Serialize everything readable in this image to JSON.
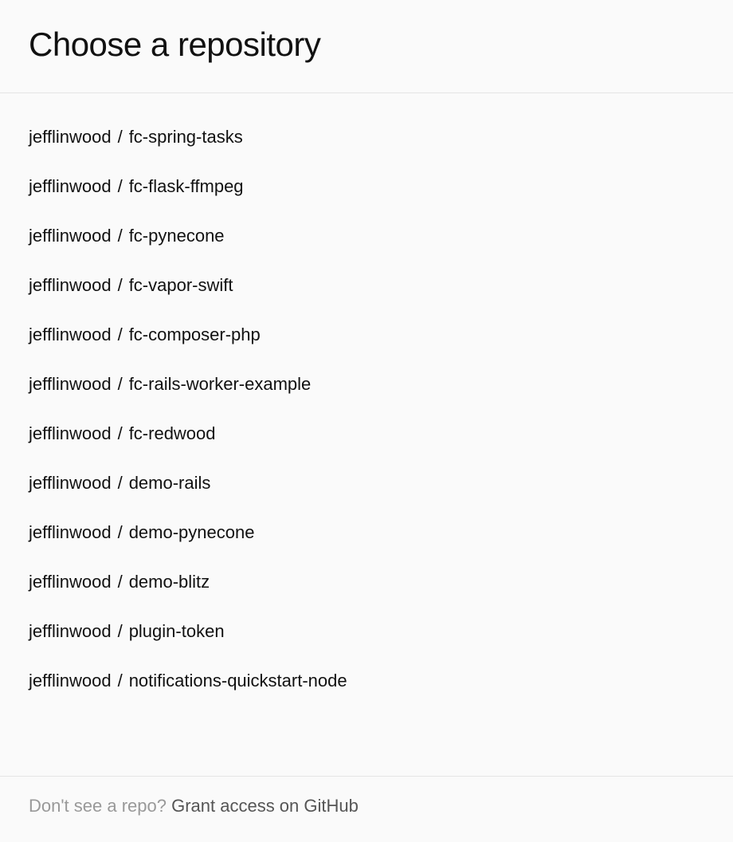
{
  "header": {
    "title": "Choose a repository"
  },
  "repositories": [
    {
      "owner": "jefflinwood",
      "name": "fc-spring-tasks"
    },
    {
      "owner": "jefflinwood",
      "name": "fc-flask-ffmpeg"
    },
    {
      "owner": "jefflinwood",
      "name": "fc-pynecone"
    },
    {
      "owner": "jefflinwood",
      "name": "fc-vapor-swift"
    },
    {
      "owner": "jefflinwood",
      "name": "fc-composer-php"
    },
    {
      "owner": "jefflinwood",
      "name": "fc-rails-worker-example"
    },
    {
      "owner": "jefflinwood",
      "name": "fc-redwood"
    },
    {
      "owner": "jefflinwood",
      "name": "demo-rails"
    },
    {
      "owner": "jefflinwood",
      "name": "demo-pynecone"
    },
    {
      "owner": "jefflinwood",
      "name": "demo-blitz"
    },
    {
      "owner": "jefflinwood",
      "name": "plugin-token"
    },
    {
      "owner": "jefflinwood",
      "name": "notifications-quickstart-node"
    }
  ],
  "footer": {
    "prompt": "Don't see a repo? ",
    "link": "Grant access on GitHub"
  },
  "separator": "/"
}
